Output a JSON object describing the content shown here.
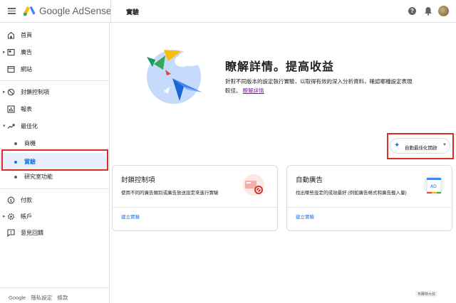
{
  "header": {
    "brand": "Google AdSense",
    "page_title": "實驗",
    "help_glyph": "?"
  },
  "sidebar": {
    "items": [
      {
        "label": "首頁",
        "icon": "home-icon"
      },
      {
        "label": "廣告",
        "icon": "ads-icon"
      },
      {
        "label": "網站",
        "icon": "sites-icon"
      },
      {
        "label": "封鎖控制項",
        "icon": "block-icon"
      },
      {
        "label": "報表",
        "icon": "reports-icon"
      },
      {
        "label": "最佳化",
        "icon": "trending-up-icon"
      },
      {
        "label": "商機"
      },
      {
        "label": "實驗"
      },
      {
        "label": "研究室功能"
      },
      {
        "label": "付款",
        "icon": "payments-icon"
      },
      {
        "label": "帳戶",
        "icon": "settings-icon"
      },
      {
        "label": "意見回饋",
        "icon": "feedback-icon"
      }
    ],
    "footer": {
      "google": "Google",
      "privacy": "隱私設定",
      "terms": "條款"
    }
  },
  "hero": {
    "title": "瞭解詳情。提高收益",
    "description": "針對不同版本的設定執行實驗，以取得有效的深入分析資料，確認哪種設定表現較佳。",
    "link": "瞭解詳情"
  },
  "auto_optimize": {
    "label": "自動最佳化開啟"
  },
  "cards": [
    {
      "title": "封鎖控制項",
      "description": "使用不同的廣告類別或廣告放送設定來進行實驗",
      "link": "建立實驗"
    },
    {
      "title": "自動廣告",
      "description": "找出哪些設定的成效最好 (例如廣告格式和廣告載入量)",
      "link": "建立實驗"
    }
  ],
  "watermark": "布蘭特大叔",
  "colors": {
    "accent": "#1a73e8",
    "highlight": "#d93025",
    "active_bg": "#e8f0fe",
    "link_purple": "#7b1fa2"
  }
}
